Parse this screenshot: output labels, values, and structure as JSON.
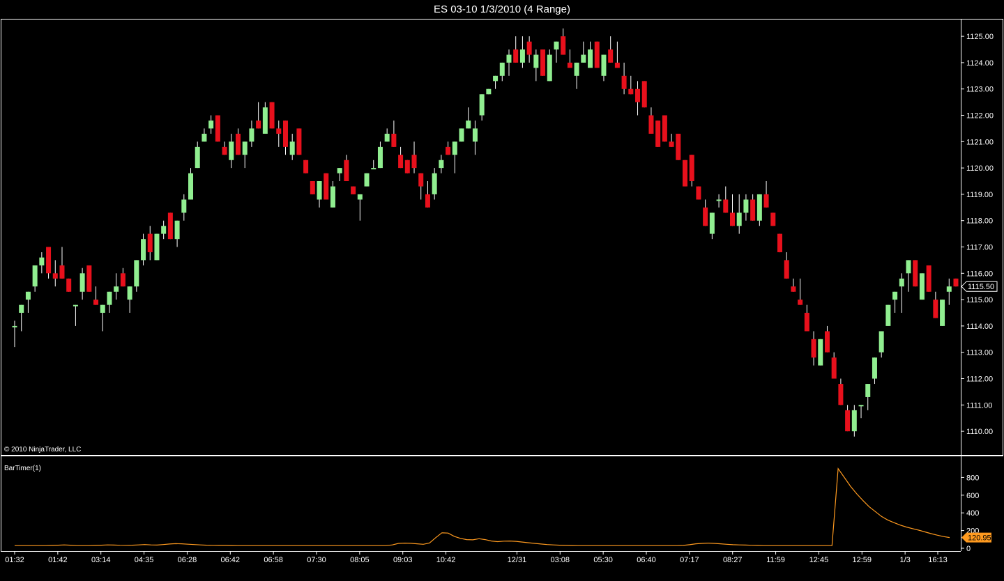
{
  "window": {
    "title": "ES 03-10  1/3/2010 (4 Range)"
  },
  "copyright": "© 2010 NinjaTrader, LLC",
  "colors": {
    "up": "#90EE90",
    "down": "#E8101C",
    "wick": "#FFFFFF",
    "indicator": "#FF9A1F",
    "border": "#FFFFFF",
    "background": "#000000"
  },
  "chart_data": [
    {
      "type": "candlestick",
      "ylim": [
        1109.5,
        1125.4
      ],
      "price_ticks": [
        "1110.00",
        "1111.00",
        "1112.00",
        "1113.00",
        "1114.00",
        "1115.00",
        "1116.00",
        "1117.00",
        "1118.00",
        "1119.00",
        "1120.00",
        "1121.00",
        "1122.00",
        "1123.00",
        "1124.00",
        "1125.00"
      ],
      "last_price": "1115.50",
      "x_tick_labels": [
        "01:32",
        "01:42",
        "03:14",
        "04:35",
        "06:28",
        "06:42",
        "06:58",
        "07:30",
        "08:05",
        "09:03",
        "10:42",
        "12/31",
        "03:08",
        "05:30",
        "06:40",
        "07:17",
        "08:27",
        "11:59",
        "12:45",
        "12:59",
        "1/3",
        "16:13"
      ],
      "bars": [
        {
          "o": 1114.0,
          "h": 1114.2,
          "l": 1113.2,
          "c": 1114.0
        },
        {
          "o": 1114.5,
          "h": 1114.8,
          "l": 1113.8,
          "c": 1114.8
        },
        {
          "o": 1115.0,
          "h": 1115.3,
          "l": 1114.5,
          "c": 1115.3
        },
        {
          "o": 1115.5,
          "h": 1116.3,
          "l": 1115.3,
          "c": 1116.3
        },
        {
          "o": 1116.3,
          "h": 1116.8,
          "l": 1116.0,
          "c": 1116.6
        },
        {
          "o": 1117.0,
          "h": 1117.0,
          "l": 1115.8,
          "c": 1116.0
        },
        {
          "o": 1116.0,
          "h": 1116.5,
          "l": 1115.5,
          "c": 1115.8
        },
        {
          "o": 1116.3,
          "h": 1117.0,
          "l": 1115.8,
          "c": 1115.8
        },
        {
          "o": 1115.8,
          "h": 1115.8,
          "l": 1115.3,
          "c": 1115.3
        },
        {
          "o": 1114.8,
          "h": 1114.8,
          "l": 1114.0,
          "c": 1114.8
        },
        {
          "o": 1115.3,
          "h": 1116.2,
          "l": 1115.0,
          "c": 1116.0
        },
        {
          "o": 1116.3,
          "h": 1116.3,
          "l": 1115.3,
          "c": 1115.3
        },
        {
          "o": 1115.0,
          "h": 1115.5,
          "l": 1114.8,
          "c": 1114.8
        },
        {
          "o": 1114.5,
          "h": 1114.8,
          "l": 1113.8,
          "c": 1114.8
        },
        {
          "o": 1114.8,
          "h": 1115.3,
          "l": 1114.5,
          "c": 1115.3
        },
        {
          "o": 1115.3,
          "h": 1116.0,
          "l": 1115.0,
          "c": 1115.5
        },
        {
          "o": 1116.0,
          "h": 1116.2,
          "l": 1115.5,
          "c": 1115.5
        },
        {
          "o": 1115.0,
          "h": 1115.5,
          "l": 1114.5,
          "c": 1115.5
        },
        {
          "o": 1115.5,
          "h": 1116.5,
          "l": 1115.3,
          "c": 1116.5
        },
        {
          "o": 1116.5,
          "h": 1117.5,
          "l": 1116.3,
          "c": 1117.3
        },
        {
          "o": 1117.5,
          "h": 1117.8,
          "l": 1116.5,
          "c": 1116.8
        },
        {
          "o": 1116.5,
          "h": 1117.5,
          "l": 1116.5,
          "c": 1117.5
        },
        {
          "o": 1117.5,
          "h": 1118.0,
          "l": 1117.3,
          "c": 1117.8
        },
        {
          "o": 1118.3,
          "h": 1118.3,
          "l": 1117.3,
          "c": 1117.3
        },
        {
          "o": 1117.3,
          "h": 1118.0,
          "l": 1117.0,
          "c": 1118.0
        },
        {
          "o": 1118.3,
          "h": 1119.0,
          "l": 1118.0,
          "c": 1118.8
        },
        {
          "o": 1118.8,
          "h": 1120.0,
          "l": 1118.8,
          "c": 1119.8
        },
        {
          "o": 1120.0,
          "h": 1121.0,
          "l": 1120.0,
          "c": 1120.8
        },
        {
          "o": 1121.0,
          "h": 1121.5,
          "l": 1121.0,
          "c": 1121.3
        },
        {
          "o": 1121.5,
          "h": 1122.0,
          "l": 1121.3,
          "c": 1121.8
        },
        {
          "o": 1122.0,
          "h": 1122.0,
          "l": 1121.0,
          "c": 1121.0
        },
        {
          "o": 1120.8,
          "h": 1121.0,
          "l": 1120.5,
          "c": 1120.5
        },
        {
          "o": 1120.3,
          "h": 1121.3,
          "l": 1120.0,
          "c": 1121.0
        },
        {
          "o": 1121.3,
          "h": 1121.5,
          "l": 1120.5,
          "c": 1120.5
        },
        {
          "o": 1120.5,
          "h": 1121.0,
          "l": 1120.0,
          "c": 1121.0
        },
        {
          "o": 1121.0,
          "h": 1121.8,
          "l": 1120.8,
          "c": 1121.5
        },
        {
          "o": 1121.8,
          "h": 1122.5,
          "l": 1121.5,
          "c": 1121.5
        },
        {
          "o": 1121.3,
          "h": 1122.5,
          "l": 1121.3,
          "c": 1122.3
        },
        {
          "o": 1122.5,
          "h": 1122.5,
          "l": 1121.5,
          "c": 1121.5
        },
        {
          "o": 1121.5,
          "h": 1121.8,
          "l": 1120.8,
          "c": 1121.3
        },
        {
          "o": 1121.8,
          "h": 1121.8,
          "l": 1120.5,
          "c": 1120.8
        },
        {
          "o": 1120.5,
          "h": 1121.3,
          "l": 1120.3,
          "c": 1121.0
        },
        {
          "o": 1121.5,
          "h": 1121.5,
          "l": 1120.5,
          "c": 1120.5
        },
        {
          "o": 1120.3,
          "h": 1120.3,
          "l": 1119.8,
          "c": 1119.8
        },
        {
          "o": 1119.5,
          "h": 1119.5,
          "l": 1119.0,
          "c": 1119.0
        },
        {
          "o": 1118.8,
          "h": 1119.5,
          "l": 1118.5,
          "c": 1119.5
        },
        {
          "o": 1119.8,
          "h": 1119.8,
          "l": 1118.8,
          "c": 1118.8
        },
        {
          "o": 1118.5,
          "h": 1119.5,
          "l": 1118.5,
          "c": 1119.3
        },
        {
          "o": 1119.8,
          "h": 1120.0,
          "l": 1119.5,
          "c": 1120.0
        },
        {
          "o": 1120.3,
          "h": 1120.5,
          "l": 1119.5,
          "c": 1119.5
        },
        {
          "o": 1119.3,
          "h": 1119.3,
          "l": 1119.0,
          "c": 1119.0
        },
        {
          "o": 1118.8,
          "h": 1119.0,
          "l": 1118.0,
          "c": 1119.0
        },
        {
          "o": 1119.3,
          "h": 1119.8,
          "l": 1119.3,
          "c": 1119.8
        },
        {
          "o": 1120.0,
          "h": 1120.3,
          "l": 1120.0,
          "c": 1120.0
        },
        {
          "o": 1120.0,
          "h": 1121.0,
          "l": 1120.0,
          "c": 1120.8
        },
        {
          "o": 1121.0,
          "h": 1121.5,
          "l": 1121.0,
          "c": 1121.3
        },
        {
          "o": 1121.3,
          "h": 1121.8,
          "l": 1120.8,
          "c": 1120.8
        },
        {
          "o": 1120.5,
          "h": 1120.8,
          "l": 1120.0,
          "c": 1120.0
        },
        {
          "o": 1120.3,
          "h": 1120.3,
          "l": 1119.8,
          "c": 1119.8
        },
        {
          "o": 1120.5,
          "h": 1121.0,
          "l": 1119.8,
          "c": 1120.0
        },
        {
          "o": 1119.8,
          "h": 1119.8,
          "l": 1118.8,
          "c": 1119.3
        },
        {
          "o": 1119.0,
          "h": 1119.5,
          "l": 1118.5,
          "c": 1118.5
        },
        {
          "o": 1119.0,
          "h": 1120.0,
          "l": 1118.8,
          "c": 1119.8
        },
        {
          "o": 1120.0,
          "h": 1120.5,
          "l": 1119.8,
          "c": 1120.3
        },
        {
          "o": 1120.8,
          "h": 1121.0,
          "l": 1120.5,
          "c": 1120.5
        },
        {
          "o": 1120.5,
          "h": 1121.0,
          "l": 1119.8,
          "c": 1121.0
        },
        {
          "o": 1121.0,
          "h": 1121.5,
          "l": 1121.0,
          "c": 1121.5
        },
        {
          "o": 1121.5,
          "h": 1122.3,
          "l": 1121.5,
          "c": 1121.8
        },
        {
          "o": 1121.0,
          "h": 1121.8,
          "l": 1120.5,
          "c": 1121.5
        },
        {
          "o": 1122.0,
          "h": 1122.8,
          "l": 1121.8,
          "c": 1122.8
        },
        {
          "o": 1122.8,
          "h": 1123.0,
          "l": 1122.8,
          "c": 1123.0
        },
        {
          "o": 1123.3,
          "h": 1123.5,
          "l": 1123.0,
          "c": 1123.5
        },
        {
          "o": 1123.5,
          "h": 1124.0,
          "l": 1123.3,
          "c": 1124.0
        },
        {
          "o": 1124.0,
          "h": 1124.5,
          "l": 1123.5,
          "c": 1124.3
        },
        {
          "o": 1124.5,
          "h": 1125.0,
          "l": 1124.0,
          "c": 1124.0
        },
        {
          "o": 1124.0,
          "h": 1125.0,
          "l": 1123.8,
          "c": 1124.5
        },
        {
          "o": 1124.8,
          "h": 1125.0,
          "l": 1124.0,
          "c": 1124.3
        },
        {
          "o": 1123.8,
          "h": 1124.5,
          "l": 1123.3,
          "c": 1124.3
        },
        {
          "o": 1124.5,
          "h": 1124.5,
          "l": 1123.5,
          "c": 1123.5
        },
        {
          "o": 1123.3,
          "h": 1124.5,
          "l": 1123.3,
          "c": 1124.3
        },
        {
          "o": 1124.5,
          "h": 1124.8,
          "l": 1124.0,
          "c": 1124.8
        },
        {
          "o": 1125.0,
          "h": 1125.3,
          "l": 1124.3,
          "c": 1124.3
        },
        {
          "o": 1124.0,
          "h": 1124.5,
          "l": 1123.8,
          "c": 1123.8
        },
        {
          "o": 1123.5,
          "h": 1124.0,
          "l": 1123.0,
          "c": 1124.0
        },
        {
          "o": 1124.0,
          "h": 1124.8,
          "l": 1124.0,
          "c": 1124.3
        },
        {
          "o": 1123.8,
          "h": 1124.8,
          "l": 1123.8,
          "c": 1124.5
        },
        {
          "o": 1124.8,
          "h": 1124.8,
          "l": 1123.8,
          "c": 1123.8
        },
        {
          "o": 1123.5,
          "h": 1124.3,
          "l": 1123.3,
          "c": 1124.3
        },
        {
          "o": 1124.5,
          "h": 1125.0,
          "l": 1124.0,
          "c": 1124.0
        },
        {
          "o": 1124.0,
          "h": 1124.8,
          "l": 1123.8,
          "c": 1123.8
        },
        {
          "o": 1123.5,
          "h": 1124.0,
          "l": 1122.8,
          "c": 1123.0
        },
        {
          "o": 1123.0,
          "h": 1123.5,
          "l": 1122.8,
          "c": 1122.8
        },
        {
          "o": 1123.0,
          "h": 1123.3,
          "l": 1122.0,
          "c": 1122.5
        },
        {
          "o": 1123.3,
          "h": 1123.3,
          "l": 1122.3,
          "c": 1122.3
        },
        {
          "o": 1122.0,
          "h": 1122.3,
          "l": 1121.3,
          "c": 1121.3
        },
        {
          "o": 1121.8,
          "h": 1121.8,
          "l": 1120.8,
          "c": 1120.8
        },
        {
          "o": 1122.0,
          "h": 1122.0,
          "l": 1121.0,
          "c": 1121.0
        },
        {
          "o": 1121.0,
          "h": 1121.3,
          "l": 1120.8,
          "c": 1120.8
        },
        {
          "o": 1121.3,
          "h": 1121.3,
          "l": 1120.3,
          "c": 1120.3
        },
        {
          "o": 1120.3,
          "h": 1120.3,
          "l": 1119.3,
          "c": 1119.3
        },
        {
          "o": 1120.5,
          "h": 1120.5,
          "l": 1119.3,
          "c": 1119.5
        },
        {
          "o": 1119.3,
          "h": 1119.3,
          "l": 1118.8,
          "c": 1118.8
        },
        {
          "o": 1118.5,
          "h": 1118.8,
          "l": 1117.8,
          "c": 1117.8
        },
        {
          "o": 1117.5,
          "h": 1118.3,
          "l": 1117.3,
          "c": 1118.3
        },
        {
          "o": 1118.8,
          "h": 1119.0,
          "l": 1118.5,
          "c": 1118.8
        },
        {
          "o": 1118.8,
          "h": 1119.3,
          "l": 1118.3,
          "c": 1118.3
        },
        {
          "o": 1118.3,
          "h": 1119.0,
          "l": 1117.8,
          "c": 1117.8
        },
        {
          "o": 1117.8,
          "h": 1119.0,
          "l": 1117.5,
          "c": 1118.3
        },
        {
          "o": 1118.3,
          "h": 1119.0,
          "l": 1118.0,
          "c": 1118.8
        },
        {
          "o": 1118.8,
          "h": 1119.0,
          "l": 1118.0,
          "c": 1118.0
        },
        {
          "o": 1118.0,
          "h": 1119.0,
          "l": 1117.8,
          "c": 1119.0
        },
        {
          "o": 1119.0,
          "h": 1119.5,
          "l": 1118.5,
          "c": 1118.5
        },
        {
          "o": 1118.3,
          "h": 1118.3,
          "l": 1117.8,
          "c": 1117.8
        },
        {
          "o": 1117.5,
          "h": 1117.5,
          "l": 1116.8,
          "c": 1116.8
        },
        {
          "o": 1116.5,
          "h": 1116.8,
          "l": 1115.8,
          "c": 1115.8
        },
        {
          "o": 1115.5,
          "h": 1115.8,
          "l": 1115.3,
          "c": 1115.3
        },
        {
          "o": 1115.0,
          "h": 1115.8,
          "l": 1114.8,
          "c": 1114.8
        },
        {
          "o": 1114.5,
          "h": 1114.8,
          "l": 1113.8,
          "c": 1113.8
        },
        {
          "o": 1113.5,
          "h": 1113.8,
          "l": 1112.5,
          "c": 1112.8
        },
        {
          "o": 1112.5,
          "h": 1113.5,
          "l": 1112.5,
          "c": 1113.5
        },
        {
          "o": 1113.8,
          "h": 1114.0,
          "l": 1113.0,
          "c": 1113.0
        },
        {
          "o": 1112.8,
          "h": 1113.0,
          "l": 1112.0,
          "c": 1112.0
        },
        {
          "o": 1111.8,
          "h": 1112.0,
          "l": 1111.0,
          "c": 1111.0
        },
        {
          "o": 1110.8,
          "h": 1111.0,
          "l": 1110.0,
          "c": 1110.0
        },
        {
          "o": 1110.0,
          "h": 1111.0,
          "l": 1109.8,
          "c": 1110.8
        },
        {
          "o": 1111.0,
          "h": 1111.0,
          "l": 1110.5,
          "c": 1111.0
        },
        {
          "o": 1111.3,
          "h": 1111.8,
          "l": 1110.8,
          "c": 1111.8
        },
        {
          "o": 1112.0,
          "h": 1112.8,
          "l": 1111.8,
          "c": 1112.8
        },
        {
          "o": 1113.0,
          "h": 1113.8,
          "l": 1112.8,
          "c": 1113.8
        },
        {
          "o": 1114.0,
          "h": 1114.8,
          "l": 1114.0,
          "c": 1114.8
        },
        {
          "o": 1115.0,
          "h": 1115.3,
          "l": 1114.5,
          "c": 1115.3
        },
        {
          "o": 1115.5,
          "h": 1116.0,
          "l": 1114.5,
          "c": 1115.8
        },
        {
          "o": 1116.0,
          "h": 1116.5,
          "l": 1115.3,
          "c": 1116.5
        },
        {
          "o": 1116.5,
          "h": 1116.5,
          "l": 1115.5,
          "c": 1115.5
        },
        {
          "o": 1115.0,
          "h": 1116.0,
          "l": 1115.0,
          "c": 1116.0
        },
        {
          "o": 1116.3,
          "h": 1116.3,
          "l": 1115.3,
          "c": 1115.3
        },
        {
          "o": 1115.0,
          "h": 1115.3,
          "l": 1114.3,
          "c": 1114.3
        },
        {
          "o": 1114.0,
          "h": 1115.0,
          "l": 1114.0,
          "c": 1115.0
        },
        {
          "o": 1115.3,
          "h": 1115.8,
          "l": 1114.8,
          "c": 1115.5
        },
        {
          "o": 1115.8,
          "h": 1115.8,
          "l": 1115.5,
          "c": 1115.5
        }
      ]
    },
    {
      "type": "line",
      "label": "BarTimer(1)",
      "ylim": [
        0,
        1000
      ],
      "y_ticks": [
        "0",
        "200",
        "400",
        "600",
        "800"
      ],
      "last_value": "120.95",
      "values": [
        30,
        30,
        30,
        30,
        30,
        30,
        32,
        35,
        38,
        35,
        30,
        30,
        30,
        32,
        35,
        38,
        36,
        34,
        33,
        35,
        38,
        42,
        38,
        36,
        42,
        48,
        52,
        50,
        46,
        42,
        38,
        35,
        33,
        32,
        32,
        31,
        30,
        30,
        30,
        30,
        30,
        30,
        30,
        30,
        30,
        30,
        30,
        30,
        30,
        30,
        30,
        30,
        30,
        30,
        30,
        30,
        30,
        30,
        30,
        30,
        30,
        38,
        55,
        58,
        56,
        50,
        45,
        60,
        120,
        175,
        172,
        135,
        112,
        98,
        95,
        108,
        98,
        82,
        75,
        80,
        82,
        78,
        70,
        62,
        55,
        48,
        42,
        38,
        35,
        32,
        31,
        30,
        30,
        30,
        30,
        30,
        30,
        30,
        30,
        30,
        30,
        30,
        30,
        30,
        30,
        30,
        30,
        30,
        32,
        40,
        50,
        55,
        58,
        55,
        50,
        45,
        40,
        38,
        36,
        34,
        32,
        30,
        30,
        30,
        30,
        30,
        30,
        30,
        30,
        30,
        30,
        30,
        30,
        900,
        800,
        700,
        615,
        540,
        470,
        415,
        360,
        320,
        290,
        262,
        240,
        222,
        205,
        185,
        165,
        148,
        132,
        121
      ]
    }
  ]
}
